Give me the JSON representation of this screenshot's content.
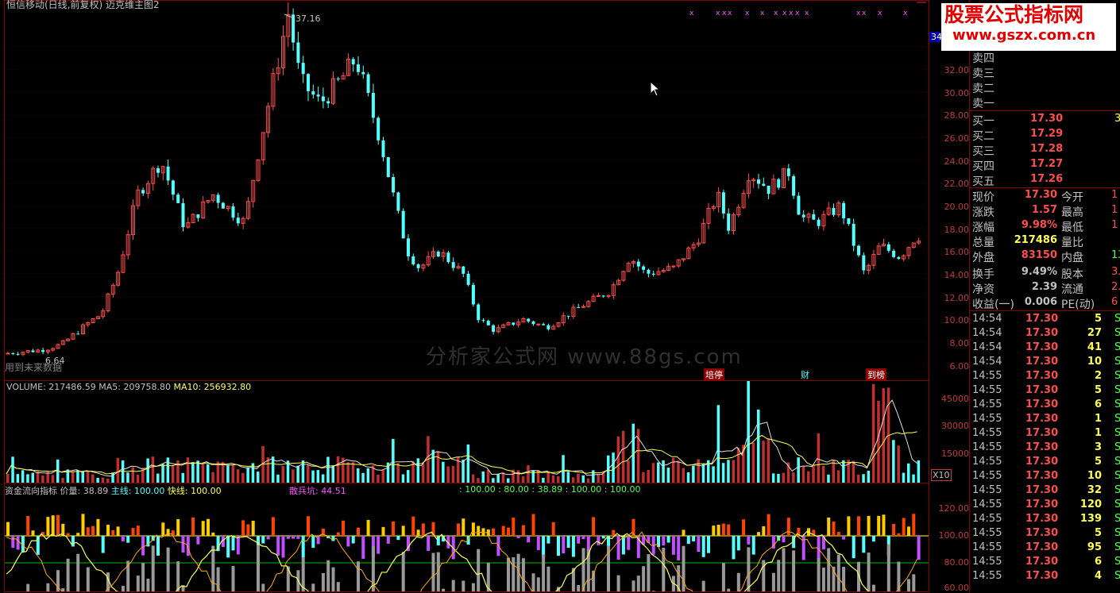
{
  "title": "恒信移动(日线,前复权) 迈克维主图2",
  "main_chart": {
    "high_label": "37.16",
    "low_label": "6.64",
    "warning": "用到未来数据",
    "y_ticks": [
      "34.00",
      "32.00",
      "30.00",
      "28.00",
      "26.00",
      "24.00",
      "22.00",
      "20.00",
      "18.00",
      "16.00",
      "14.00",
      "12.00",
      "10.00",
      "8.00",
      "6.00"
    ],
    "price_tag": "34",
    "event_labels": [
      "培停",
      "财",
      "到榜"
    ],
    "watermark": "分析家公式网 www.88gs.com",
    "marker_glyph": "x"
  },
  "volume_panel": {
    "label_volume": "VOLUME: 217486.59",
    "label_ma5": "MA5: 209758.80",
    "label_ma10": "MA10: 256932.80",
    "y_ticks": [
      "45000",
      "30000",
      "15000"
    ],
    "unit": "X10"
  },
  "flow_panel": {
    "name": "资金流向指标",
    "price_vol": "价量: 38.89",
    "main_line": "主线: 100.00",
    "fast_line": "快线: 100.00",
    "retail_pit": "散兵坑: 44.51",
    "extra_values": ": 100.00 : 80.00 : 38.89 : 100.00 : 100.00",
    "y_ticks": [
      "120.00",
      "100.00",
      "80.00",
      "60.00"
    ]
  },
  "quote_panel": {
    "sell_rows": [
      "卖四",
      "卖三",
      "卖二",
      "卖一"
    ],
    "buy_rows": [
      {
        "label": "买一",
        "price": "17.30",
        "vol": "3"
      },
      {
        "label": "买二",
        "price": "17.29",
        "vol": ""
      },
      {
        "label": "买三",
        "price": "17.28",
        "vol": ""
      },
      {
        "label": "买四",
        "price": "17.27",
        "vol": ""
      },
      {
        "label": "买五",
        "price": "17.26",
        "vol": ""
      }
    ],
    "stats": [
      {
        "l1": "现价",
        "v1": "17.30",
        "l2": "今开",
        "v2": "1"
      },
      {
        "l1": "涨跌",
        "v1": "1.57",
        "l2": "最高",
        "v2": "1"
      },
      {
        "l1": "涨幅",
        "v1": "9.98%",
        "l2": "最低",
        "v2": "1"
      },
      {
        "l1": "总量",
        "v1": "217486",
        "l2": "量比",
        "v2": ""
      },
      {
        "l1": "外盘",
        "v1": "83150",
        "l2": "内盘",
        "v2": "13"
      },
      {
        "l1": "换手",
        "v1": "9.49%",
        "l2": "股本",
        "v2": "3."
      },
      {
        "l1": "净资",
        "v1": "2.39",
        "l2": "流通",
        "v2": "2."
      },
      {
        "l1": "收益(一)",
        "v1": "0.006",
        "l2": "PE(动)",
        "v2": "6"
      }
    ],
    "ticks": [
      {
        "t": "14:54",
        "p": "17.30",
        "v": "5",
        "s": "S"
      },
      {
        "t": "14:54",
        "p": "17.30",
        "v": "27",
        "s": "S"
      },
      {
        "t": "14:54",
        "p": "17.30",
        "v": "41",
        "s": "S"
      },
      {
        "t": "14:54",
        "p": "17.30",
        "v": "10",
        "s": "S"
      },
      {
        "t": "14:55",
        "p": "17.30",
        "v": "2",
        "s": "S"
      },
      {
        "t": "14:55",
        "p": "17.30",
        "v": "5",
        "s": "S"
      },
      {
        "t": "14:55",
        "p": "17.30",
        "v": "6",
        "s": "S"
      },
      {
        "t": "14:55",
        "p": "17.30",
        "v": "1",
        "s": "S"
      },
      {
        "t": "14:55",
        "p": "17.30",
        "v": "1",
        "s": "S"
      },
      {
        "t": "14:55",
        "p": "17.30",
        "v": "3",
        "s": "S"
      },
      {
        "t": "14:55",
        "p": "17.30",
        "v": "5",
        "s": "S"
      },
      {
        "t": "14:55",
        "p": "17.30",
        "v": "10",
        "s": "S"
      },
      {
        "t": "14:55",
        "p": "17.30",
        "v": "32",
        "s": "S"
      },
      {
        "t": "14:55",
        "p": "17.30",
        "v": "120",
        "s": "S"
      },
      {
        "t": "14:55",
        "p": "17.30",
        "v": "139",
        "s": "S"
      },
      {
        "t": "14:55",
        "p": "17.30",
        "v": "5",
        "s": "S"
      },
      {
        "t": "14:55",
        "p": "17.30",
        "v": "95",
        "s": "S"
      },
      {
        "t": "14:55",
        "p": "17.30",
        "v": "6",
        "s": "S"
      },
      {
        "t": "14:55",
        "p": "17.30",
        "v": "4",
        "s": "S"
      }
    ]
  },
  "site_logo": {
    "line1": "股票公式指标网",
    "line2": "www.gszx.com.cn"
  },
  "colors": {
    "up": "#ff4d4d",
    "down": "#54ffff",
    "grid": "#8b0000",
    "text": "#c0c0c0",
    "yellow": "#ffff54",
    "magenta": "#ff54ff"
  }
}
